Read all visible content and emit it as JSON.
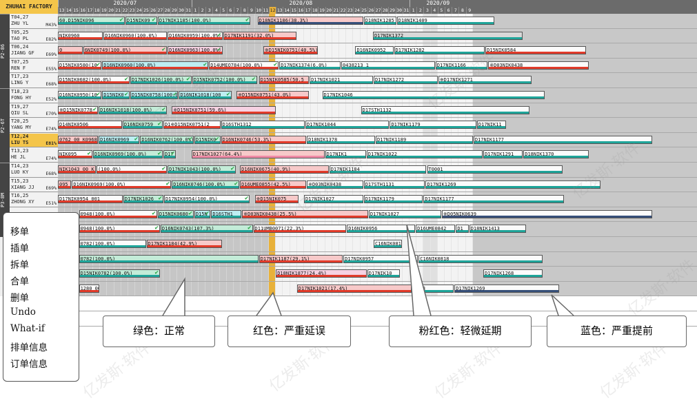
{
  "app": {
    "factory_label": "ZHUHAI FACTORY"
  },
  "header": {
    "months": [
      {
        "label": "2020/07",
        "first": 0,
        "count": 19
      },
      {
        "label": "2020/08",
        "first": 19,
        "count": 31
      },
      {
        "label": "2020/09",
        "first": 50,
        "count": 8
      }
    ],
    "days": [
      "13",
      "14",
      "15",
      "16",
      "17",
      "18",
      "19",
      "20",
      "21",
      "22",
      "23",
      "24",
      "25",
      "26",
      "27",
      "28",
      "29",
      "30",
      "31",
      "1",
      "2",
      "3",
      "4",
      "5",
      "6",
      "7",
      "8",
      "9",
      "10",
      "11",
      "12",
      "13",
      "14",
      "15",
      "16",
      "17",
      "18",
      "19",
      "20",
      "21",
      "22",
      "23",
      "24",
      "25",
      "26",
      "27",
      "28",
      "29",
      "30",
      "31",
      "1",
      "2",
      "3",
      "4",
      "5",
      "6",
      "7",
      "8",
      "9"
    ],
    "today_day_index": 30,
    "weekend_day_indices": [
      52,
      53,
      59,
      60
    ]
  },
  "groups": [
    {
      "label": "P2-86",
      "first_row": 0,
      "rows": 5
    },
    {
      "label": "P2-6T",
      "first_row": 5,
      "rows": 5
    },
    {
      "label": "P3-8M",
      "first_row": 10,
      "rows": 5
    }
  ],
  "machines": [
    {
      "code": "T04,27",
      "op": "ZHU YL",
      "pct": "M43%"
    },
    {
      "code": "T05,25",
      "op": "TAO PL",
      "pct": "E82%"
    },
    {
      "code": "T06,24",
      "op": "JIANG GF",
      "pct": "E69%"
    },
    {
      "code": "T07,25",
      "op": "REN F",
      "pct": "E55%"
    },
    {
      "code": "T17,23",
      "op": "LING Y",
      "pct": "E68%"
    },
    {
      "code": "T18,23",
      "op": "FONG HY",
      "pct": "E52%"
    },
    {
      "code": "T19,27",
      "op": "QIU SL",
      "pct": "E70%"
    },
    {
      "code": "T20,25",
      "op": "YANG MY",
      "pct": "E74%"
    },
    {
      "code": "T12,24",
      "op": "LIU TS",
      "pct": "E81%",
      "highlight": true
    },
    {
      "code": "T13,23",
      "op": "HE JL",
      "pct": "E74%"
    },
    {
      "code": "T14,23",
      "op": "LUO KY",
      "pct": "E68%"
    },
    {
      "code": "T15,23",
      "op": "XIANG JJ",
      "pct": "E69%"
    },
    {
      "code": "T16,25",
      "op": "ZHONG XY",
      "pct": "E51%"
    },
    {
      "code": "",
      "op": "",
      "pct": ""
    },
    {
      "code": "",
      "op": "",
      "pct": ""
    },
    {
      "code": "",
      "op": "",
      "pct": ""
    },
    {
      "code": "",
      "op": "",
      "pct": ""
    },
    {
      "code": "",
      "op": "",
      "pct": ""
    },
    {
      "code": "",
      "op": "",
      "pct": ""
    },
    {
      "code": "",
      "op": "",
      "pct": ""
    },
    {
      "code": "",
      "op": "",
      "pct": ""
    }
  ],
  "orders": [
    {
      "row": 0,
      "s": 0,
      "e": 9.6,
      "label": "60,D15NIK096",
      "fill": "green",
      "line": "teal",
      "check": true
    },
    {
      "row": 0,
      "s": 9.6,
      "e": 14.2,
      "label": "D15NIK09",
      "fill": "green",
      "line": "teal",
      "check": true
    },
    {
      "row": 0,
      "s": 14.2,
      "e": 27.5,
      "label": "D17NIK1185(100.0%)",
      "fill": "green",
      "line": "teal",
      "check": true
    },
    {
      "row": 0,
      "s": 28.4,
      "e": 43.5,
      "label": "D18NIK1186(38.3%)",
      "fill": "red",
      "line": "blue"
    },
    {
      "row": 0,
      "s": 43.5,
      "e": 48.2,
      "label": "D18NIK1285",
      "fill": "white",
      "line": "teal"
    },
    {
      "row": 0,
      "s": 48.2,
      "e": 62.2,
      "label": "D18NIK1409",
      "fill": "white",
      "line": "teal"
    },
    {
      "row": 1,
      "s": 0,
      "e": 6.5,
      "label": "NIK0960",
      "fill": "white",
      "line": "red"
    },
    {
      "row": 1,
      "s": 6.5,
      "e": 15.6,
      "label": "D16NIK0960(100.0%)",
      "fill": "white",
      "line": "red"
    },
    {
      "row": 1,
      "s": 15.6,
      "e": 23.5,
      "label": "D16NIK0959(100.0%)",
      "fill": "white",
      "line": "red",
      "check": true
    },
    {
      "row": 1,
      "s": 23.5,
      "e": 34.0,
      "label": "D17NIK1191(32.0%)",
      "fill": "red",
      "line": "red"
    },
    {
      "row": 1,
      "s": 44.8,
      "e": 66.2,
      "label": "D17NIK1372",
      "fill": "gray",
      "line": "teal"
    },
    {
      "row": 2,
      "s": 0,
      "e": 3.6,
      "label": "0",
      "fill": "red",
      "line": "red"
    },
    {
      "row": 2,
      "s": 3.6,
      "e": 15.6,
      "label": "6NIK0749(100.0%)",
      "fill": "red",
      "line": "red",
      "check": true
    },
    {
      "row": 2,
      "s": 15.6,
      "e": 23.5,
      "label": "D16NIK0963(100.0%)",
      "fill": "pink",
      "line": "red",
      "check": true
    },
    {
      "row": 2,
      "s": 29.2,
      "e": 37.1,
      "label": "※D15NIK0751(40.5%)",
      "fill": "red",
      "line": "red"
    },
    {
      "row": 2,
      "s": 42.3,
      "e": 47.8,
      "label": "D16NIK0952",
      "fill": "white",
      "line": "teal"
    },
    {
      "row": 2,
      "s": 47.8,
      "e": 60.8,
      "label": "D17NIK1282",
      "fill": "white",
      "line": "teal"
    },
    {
      "row": 2,
      "s": 60.8,
      "e": 75.2,
      "label": "D15NIK0584",
      "fill": "white",
      "line": "red"
    },
    {
      "row": 3,
      "s": 0,
      "e": 6.3,
      "label": "D15NIK0580(10",
      "fill": "white",
      "line": "red",
      "check": true
    },
    {
      "row": 3,
      "s": 6.3,
      "e": 21.5,
      "label": "D16NIK0960(100.0%)",
      "fill": "cyan",
      "line": "red",
      "check": true
    },
    {
      "row": 3,
      "s": 21.5,
      "e": 31.5,
      "label": "D14UMEO784(100.0%)",
      "fill": "white",
      "line": "red",
      "check": true
    },
    {
      "row": 3,
      "s": 31.5,
      "e": 40.3,
      "label": "D17NIK1374(6.0%)",
      "fill": "white",
      "line": "teal"
    },
    {
      "row": 3,
      "s": 40.3,
      "e": 53.7,
      "label": "0438213 1",
      "fill": "white",
      "line": "teal"
    },
    {
      "row": 3,
      "s": 53.7,
      "e": 61.2,
      "label": "D17NIK1166",
      "fill": "white",
      "line": "teal"
    },
    {
      "row": 3,
      "s": 61.2,
      "e": 75.6,
      "label": "※D03NIK0438",
      "fill": "white",
      "line": "red"
    },
    {
      "row": 4,
      "s": 0,
      "e": 10.3,
      "label": "D15NIK0682(100.0%)",
      "fill": "white",
      "line": "red",
      "check": true
    },
    {
      "row": 4,
      "s": 10.3,
      "e": 19.1,
      "label": "D17NIK1026(100.0%)",
      "fill": "green",
      "line": "teal",
      "check": true
    },
    {
      "row": 4,
      "s": 19.1,
      "e": 28.4,
      "label": "D15NIK0752(100.0%)",
      "fill": "green",
      "line": "teal",
      "check": true
    },
    {
      "row": 4,
      "s": 28.6,
      "e": 35.8,
      "label": "D15NIK0585(50.5",
      "fill": "red",
      "line": "red"
    },
    {
      "row": 4,
      "s": 35.8,
      "e": 44.9,
      "label": "D17NIK1021",
      "fill": "white",
      "line": "teal"
    },
    {
      "row": 4,
      "s": 44.9,
      "e": 54.1,
      "label": "D17NIK1272",
      "fill": "white",
      "line": "teal"
    },
    {
      "row": 4,
      "s": 54.1,
      "e": 67.5,
      "label": "※D17NIK1271",
      "fill": "white",
      "line": "teal"
    },
    {
      "row": 5,
      "s": 0,
      "e": 6.3,
      "label": "D16NIK0950(10",
      "fill": "white",
      "line": "teal",
      "check": true
    },
    {
      "row": 5,
      "s": 6.3,
      "e": 10.3,
      "label": "D15NIK0",
      "fill": "cyan",
      "line": "teal",
      "check": true
    },
    {
      "row": 5,
      "s": 10.3,
      "e": 17.2,
      "label": "D15NIK0758(100.0%)",
      "fill": "cyan",
      "line": "teal",
      "check": true
    },
    {
      "row": 5,
      "s": 17.2,
      "e": 24.8,
      "label": "D16NIK1018(100",
      "fill": "cyan",
      "line": "teal",
      "check": true
    },
    {
      "row": 5,
      "s": 25.4,
      "e": 35.8,
      "label": "※D15NIK0751(43.0%)",
      "fill": "red",
      "line": "red"
    },
    {
      "row": 5,
      "s": 37.6,
      "e": 69.3,
      "label": "D17NIK1046",
      "fill": "white",
      "line": "teal"
    },
    {
      "row": 6,
      "s": 0,
      "e": 5.8,
      "label": "※D15NIK0778",
      "fill": "white",
      "line": "red",
      "check": true
    },
    {
      "row": 6,
      "s": 5.8,
      "e": 15.6,
      "label": "D16NIK1018(100.0%)",
      "fill": "green",
      "line": "teal",
      "check": true
    },
    {
      "row": 6,
      "s": 16.2,
      "e": 31.1,
      "label": "※D15NIK0751(59.6%)",
      "fill": "pink",
      "line": "red"
    },
    {
      "row": 6,
      "s": 43.1,
      "e": 67.2,
      "label": "D17STH1132",
      "fill": "white",
      "line": "teal"
    },
    {
      "row": 7,
      "s": 0,
      "e": 9.2,
      "label": "D14NIK0506",
      "fill": "white",
      "line": "red"
    },
    {
      "row": 7,
      "s": 9.2,
      "e": 15.0,
      "label": "D16NIK0759",
      "fill": "green",
      "line": "teal",
      "check": true
    },
    {
      "row": 7,
      "s": 15.0,
      "e": 23.2,
      "label": "D1※D15NIK0751(2",
      "fill": "white",
      "line": "red"
    },
    {
      "row": 7,
      "s": 23.2,
      "e": 35.2,
      "label": "D16STH1312",
      "fill": "white",
      "line": "teal"
    },
    {
      "row": 7,
      "s": 35.2,
      "e": 47.2,
      "label": "D17NIK1044",
      "fill": "white",
      "line": "teal"
    },
    {
      "row": 7,
      "s": 47.2,
      "e": 59.6,
      "label": "D17NIK1179",
      "fill": "white",
      "line": "teal"
    },
    {
      "row": 7,
      "s": 59.6,
      "e": 63.8,
      "label": "D17NIK11",
      "fill": "white",
      "line": "teal"
    },
    {
      "row": 8,
      "s": 0,
      "e": 5.8,
      "label": "0762 00 K0968",
      "fill": "red",
      "line": "red"
    },
    {
      "row": 8,
      "s": 5.8,
      "e": 11.7,
      "label": "D16NIK0969",
      "fill": "cyan",
      "line": "teal",
      "check": true
    },
    {
      "row": 8,
      "s": 11.7,
      "e": 19.4,
      "label": "D16NIK0762(100.0%)",
      "fill": "green",
      "line": "teal",
      "check": true
    },
    {
      "row": 8,
      "s": 19.4,
      "e": 23.2,
      "label": "D15NIK0",
      "fill": "green",
      "line": "teal",
      "check": true
    },
    {
      "row": 8,
      "s": 23.2,
      "e": 35.4,
      "label": "D16NIK0746(53.3%)",
      "fill": "red",
      "line": "red"
    },
    {
      "row": 8,
      "s": 35.4,
      "e": 45.2,
      "label": "D18NIK1378",
      "fill": "white",
      "line": "teal"
    },
    {
      "row": 8,
      "s": 45.2,
      "e": 59.1,
      "label": "D17NIK1189",
      "fill": "white",
      "line": "teal"
    },
    {
      "row": 8,
      "s": 59.1,
      "e": 84.6,
      "label": "D17NIK1177",
      "fill": "white",
      "line": "teal"
    },
    {
      "row": 9,
      "s": 0,
      "e": 5.0,
      "label": "NIK095",
      "fill": "white",
      "line": "red",
      "check": true
    },
    {
      "row": 9,
      "s": 5.0,
      "e": 15.0,
      "label": "D16NIK0969(100.0%)",
      "fill": "green",
      "line": "teal",
      "check": true
    },
    {
      "row": 9,
      "s": 15.0,
      "e": 16.9,
      "label": "D17",
      "fill": "green",
      "line": "teal",
      "check": true
    },
    {
      "row": 9,
      "s": 19.0,
      "e": 38.0,
      "label": "D17NIK1027(64.4%)",
      "fill": "red",
      "line": "pink"
    },
    {
      "row": 9,
      "s": 38.0,
      "e": 43.9,
      "label": "D17NIK1",
      "fill": "white",
      "line": "teal"
    },
    {
      "row": 9,
      "s": 43.9,
      "e": 60.5,
      "label": "D17NIK1022",
      "fill": "white",
      "line": "teal"
    },
    {
      "row": 9,
      "s": 60.5,
      "e": 66.2,
      "label": "D17NIK1291",
      "fill": "white",
      "line": "teal"
    },
    {
      "row": 9,
      "s": 66.2,
      "e": 75.6,
      "label": "D18NIK1370",
      "fill": "white",
      "line": "teal"
    },
    {
      "row": 10,
      "s": 0,
      "e": 5.5,
      "label": "NIK1043 00 K",
      "fill": "red",
      "line": "red"
    },
    {
      "row": 10,
      "s": 5.5,
      "e": 15.6,
      "label": "(100.0%)",
      "fill": "white",
      "line": "red",
      "check": true
    },
    {
      "row": 10,
      "s": 15.6,
      "e": 25.4,
      "label": "D17NIK1043(100.0%)",
      "fill": "green",
      "line": "teal",
      "check": true
    },
    {
      "row": 10,
      "s": 25.9,
      "e": 38.6,
      "label": "D16NIK0675(40.9%)",
      "fill": "red",
      "line": "red"
    },
    {
      "row": 10,
      "s": 38.6,
      "e": 52.5,
      "label": "D17NIK1184",
      "fill": "white",
      "line": "teal"
    },
    {
      "row": 10,
      "s": 52.5,
      "e": 71.9,
      "label": "T0001",
      "fill": "white",
      "line": "teal"
    },
    {
      "row": 11,
      "s": 0,
      "e": 2.0,
      "label": "095",
      "fill": "red",
      "line": "red"
    },
    {
      "row": 11,
      "s": 2.0,
      "e": 16.2,
      "label": "D16NIK0969(100.0%)",
      "fill": "white",
      "line": "red",
      "check": true
    },
    {
      "row": 11,
      "s": 16.2,
      "e": 25.9,
      "label": "D16NIK0746(100.0%)",
      "fill": "green",
      "line": "teal",
      "check": true
    },
    {
      "row": 11,
      "s": 25.9,
      "e": 35.4,
      "label": "D16UMEO855(42.5%)",
      "fill": "red",
      "line": "red"
    },
    {
      "row": 11,
      "s": 35.4,
      "e": 43.5,
      "label": "※D03NIK0438",
      "fill": "white",
      "line": "teal"
    },
    {
      "row": 11,
      "s": 43.5,
      "e": 52.3,
      "label": "D17STH1131",
      "fill": "white",
      "line": "teal"
    },
    {
      "row": 11,
      "s": 52.3,
      "e": 77.3,
      "label": "D17NIK1269",
      "fill": "white",
      "line": "teal"
    },
    {
      "row": 12,
      "s": 0,
      "e": 9.3,
      "label": "D17NIK0954 001",
      "fill": "white",
      "line": "red"
    },
    {
      "row": 12,
      "s": 9.3,
      "e": 15.1,
      "label": "D17NIK1026",
      "fill": "green",
      "line": "teal",
      "check": true
    },
    {
      "row": 12,
      "s": 15.1,
      "e": 27.4,
      "label": "D17NIK0954(100.0%)",
      "fill": "white",
      "line": "teal",
      "check": true
    },
    {
      "row": 12,
      "s": 28.0,
      "e": 34.3,
      "label": "※D15NIK075",
      "fill": "red",
      "line": "red"
    },
    {
      "row": 12,
      "s": 35.0,
      "e": 43.5,
      "label": "D17NIK1027",
      "fill": "white",
      "line": "teal"
    },
    {
      "row": 12,
      "s": 43.5,
      "e": 52.0,
      "label": "D17NIK1179",
      "fill": "white",
      "line": "teal"
    },
    {
      "row": 12,
      "s": 52.0,
      "e": 72.1,
      "label": "D17NIK1177",
      "fill": "white",
      "line": "teal"
    },
    {
      "row": 13,
      "s": 3.0,
      "e": 14.2,
      "label": "0948(100.0%)",
      "fill": "white",
      "line": "red",
      "check": true
    },
    {
      "row": 13,
      "s": 14.2,
      "e": 19.4,
      "label": "D15NIK0680",
      "fill": "green",
      "line": "teal",
      "check": true
    },
    {
      "row": 13,
      "s": 19.4,
      "e": 21.8,
      "label": "D15N",
      "fill": "cyan",
      "line": "teal",
      "check": true
    },
    {
      "row": 13,
      "s": 21.8,
      "e": 26.2,
      "label": "D16STH1",
      "fill": "cyan",
      "line": "teal"
    },
    {
      "row": 13,
      "s": 26.2,
      "e": 44.2,
      "label": "※D03NIK0438(25.5%)",
      "fill": "red",
      "line": "red"
    },
    {
      "row": 13,
      "s": 44.2,
      "e": 54.6,
      "label": "D17NIK1027",
      "fill": "white",
      "line": "teal"
    },
    {
      "row": 13,
      "s": 54.6,
      "e": 84.6,
      "label": "※D05NIK0639",
      "fill": "white",
      "line": "blue"
    },
    {
      "row": 14,
      "s": 3.0,
      "e": 14.6,
      "label": "0948(100.0%)",
      "fill": "white",
      "line": "red",
      "check": true
    },
    {
      "row": 14,
      "s": 14.6,
      "e": 27.8,
      "label": "D16NIK0743(107.3%)",
      "fill": "green",
      "line": "teal",
      "check": true
    },
    {
      "row": 14,
      "s": 27.8,
      "e": 41.1,
      "label": "D11UMB0071(22.3%)",
      "fill": "white",
      "line": "red"
    },
    {
      "row": 14,
      "s": 41.1,
      "e": 50.9,
      "label": "D16NIK0956",
      "fill": "white",
      "line": "teal"
    },
    {
      "row": 14,
      "s": 50.9,
      "e": 56.6,
      "label": "D16UME0842",
      "fill": "white",
      "line": "teal"
    },
    {
      "row": 14,
      "s": 56.6,
      "e": 58.5,
      "label": "D1",
      "fill": "white",
      "line": "teal"
    },
    {
      "row": 14,
      "s": 58.5,
      "e": 66.7,
      "label": "D18NIK1413",
      "fill": "white",
      "line": "teal"
    },
    {
      "row": 15,
      "s": 3.0,
      "e": 12.6,
      "label": "0782(100.0%)",
      "fill": "white",
      "line": "teal"
    },
    {
      "row": 15,
      "s": 12.6,
      "e": 23.4,
      "label": "D17NIK1184(42.9%)",
      "fill": "red",
      "line": "red"
    },
    {
      "row": 15,
      "s": 44.9,
      "e": 49.0,
      "label": "C16NIK081",
      "fill": "white",
      "line": "teal"
    },
    {
      "row": 16,
      "s": 3.0,
      "e": 28.6,
      "label": "0782(100.0%)",
      "fill": "green",
      "line": "teal"
    },
    {
      "row": 16,
      "s": 28.6,
      "e": 40.6,
      "label": "D17NIK1187(29.1%)",
      "fill": "red",
      "line": "red"
    },
    {
      "row": 16,
      "s": 40.6,
      "e": 51.3,
      "label": "D17NIK0957",
      "fill": "white",
      "line": "teal"
    },
    {
      "row": 16,
      "s": 51.3,
      "e": 69.0,
      "label": "C16NIK0818",
      "fill": "white",
      "line": "teal"
    },
    {
      "row": 17,
      "s": 3.0,
      "e": 14.6,
      "label": "D15NIK0782(100.0%)",
      "fill": "green",
      "line": "teal",
      "check": true
    },
    {
      "row": 17,
      "s": 31.0,
      "e": 44.0,
      "label": "D18NIK1877(24.4%)",
      "fill": "pink",
      "line": "red"
    },
    {
      "row": 17,
      "s": 44.0,
      "e": 48.7,
      "label": "D17NIK10",
      "fill": "white",
      "line": "teal"
    },
    {
      "row": 17,
      "s": 60.5,
      "e": 69.0,
      "label": "D17NIK1268",
      "fill": "white",
      "line": "teal"
    },
    {
      "row": 18,
      "s": 3.0,
      "e": 6.0,
      "label": "1280 001",
      "fill": "white",
      "line": "red"
    },
    {
      "row": 18,
      "s": 34.0,
      "e": 50.4,
      "label": "D17NIK1021(17.4%)",
      "fill": "red",
      "line": "red"
    },
    {
      "row": 18,
      "s": 50.4,
      "e": 56.4,
      "label": "K118",
      "fill": "white",
      "line": "teal"
    },
    {
      "row": 18,
      "s": 56.4,
      "e": 71.4,
      "label": "D17NIK1269",
      "fill": "white",
      "line": "blue"
    }
  ],
  "menu": {
    "items": [
      "移单",
      "插单",
      "拆单",
      "合单",
      "删单",
      "Undo",
      "What-if",
      "排单信息",
      "订单信息"
    ]
  },
  "legend": [
    {
      "text": "绿色：正常",
      "color": "#1f9e8e"
    },
    {
      "text": "红色：严重延误",
      "color": "#e0201a"
    },
    {
      "text": "粉红色：轻微延期",
      "color": "#f06aa0"
    },
    {
      "text": "蓝色：严重提前",
      "color": "#2a3a66"
    }
  ],
  "watermark": {
    "text": "亿发斯·软件"
  }
}
